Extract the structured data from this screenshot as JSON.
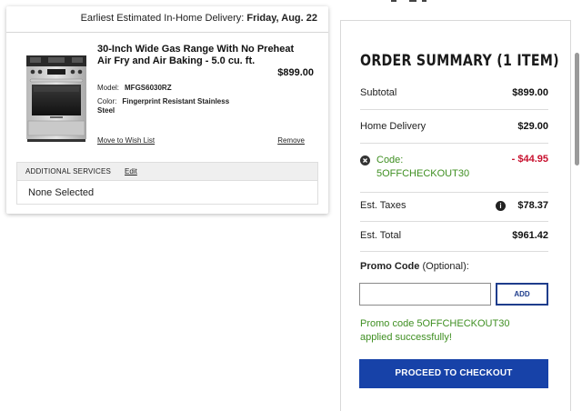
{
  "cart": {
    "delivery_label": "Earliest Estimated In-Home Delivery:",
    "delivery_date": "Friday, Aug. 22",
    "item": {
      "image": "gas-range-icon",
      "title": "30-Inch Wide Gas Range With No Preheat Air Fry and Air Baking - 5.0 cu. ft.",
      "price": "$899.00",
      "model_label": "Model:",
      "model_value": "MFGS6030RZ",
      "color_label": "Color:",
      "color_value": "Fingerprint Resistant Stainless Steel",
      "wishlist_link": "Move to Wish List",
      "remove_link": "Remove"
    },
    "services": {
      "header": "ADDITIONAL SERVICES",
      "edit_link": "Edit",
      "value": "None Selected"
    }
  },
  "summary": {
    "title": "ORDER SUMMARY (1 ITEM)",
    "subtotal_label": "Subtotal",
    "subtotal_value": "$899.00",
    "delivery_label": "Home Delivery",
    "delivery_value": "$29.00",
    "code_label": "Code:",
    "code_value": "5OFFCHECKOUT30",
    "code_discount": "- $44.95",
    "taxes_label": "Est. Taxes",
    "taxes_value": "$78.37",
    "total_label": "Est. Total",
    "total_value": "$961.42",
    "promo_label": "Promo Code",
    "promo_optional": "(Optional):",
    "promo_placeholder": "",
    "add_button": "ADD",
    "promo_message": "Promo code 5OFFCHECKOUT30 applied successfully!",
    "checkout_button": "PROCEED TO CHECKOUT"
  },
  "colors": {
    "accent_blue": "#1742a8",
    "success_green": "#3f8f22",
    "discount_red": "#c8102e"
  }
}
